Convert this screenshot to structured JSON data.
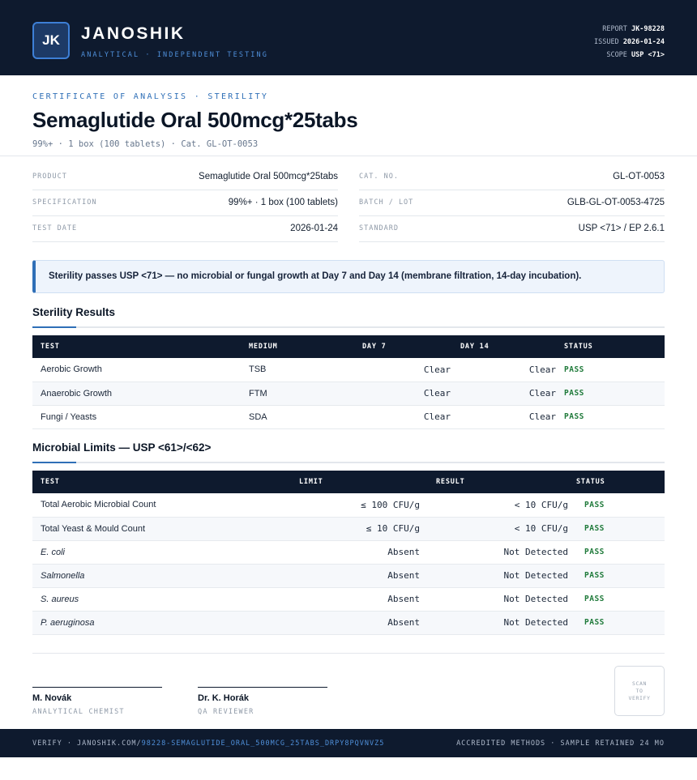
{
  "header": {
    "logo_initials": "JK",
    "brand": "JANOSHIK",
    "tagline": "ANALYTICAL · INDEPENDENT TESTING",
    "report_label": "REPORT",
    "report_value": "JK-98228",
    "issued_label": "ISSUED",
    "issued_value": "2026-01-24",
    "scope_label": "SCOPE",
    "scope_value": "USP <71>"
  },
  "doc": {
    "kicker": "CERTIFICATE OF ANALYSIS · STERILITY",
    "title": "Semaglutide Oral 500mcg*25tabs",
    "subtitle": "99%+ · 1 box (100 tablets)  ·  Cat. GL-OT-0053"
  },
  "info": {
    "product_label": "PRODUCT",
    "product_value": "Semaglutide Oral 500mcg*25tabs",
    "spec_label": "SPECIFICATION",
    "spec_value": "99%+ · 1 box (100 tablets)",
    "date_label": "TEST DATE",
    "date_value": "2026-01-24",
    "cat_label": "CAT. NO.",
    "cat_value": "GL-OT-0053",
    "batch_label": "BATCH / LOT",
    "batch_value": "GLB-GL-OT-0053-4725",
    "standard_label": "STANDARD",
    "standard_value": "USP <71> / EP 2.6.1"
  },
  "notice": "Sterility passes USP <71> — no microbial or fungal growth at Day 7 and Day 14 (membrane filtration, 14-day incubation).",
  "sterility": {
    "title": "Sterility Results",
    "headers": [
      "TEST",
      "MEDIUM",
      "DAY 7",
      "DAY 14",
      "STATUS"
    ],
    "rows": [
      {
        "test": "Aerobic Growth",
        "medium": "TSB",
        "day7": "Clear",
        "day14": "Clear",
        "status": "PASS"
      },
      {
        "test": "Anaerobic Growth",
        "medium": "FTM",
        "day7": "Clear",
        "day14": "Clear",
        "status": "PASS"
      },
      {
        "test": "Fungi / Yeasts",
        "medium": "SDA",
        "day7": "Clear",
        "day14": "Clear",
        "status": "PASS"
      }
    ]
  },
  "microbial": {
    "title": "Microbial Limits — USP <61>/<62>",
    "headers": [
      "TEST",
      "LIMIT",
      "RESULT",
      "STATUS"
    ],
    "rows": [
      {
        "test": "Total Aerobic Microbial Count",
        "limit": "≤ 100 CFU/g",
        "result": "< 10 CFU/g",
        "status": "PASS"
      },
      {
        "test": "Total Yeast & Mould Count",
        "limit": "≤ 10 CFU/g",
        "result": "< 10 CFU/g",
        "status": "PASS"
      },
      {
        "test": "E. coli",
        "limit": "Absent",
        "result": "Not Detected",
        "status": "PASS"
      },
      {
        "test": "Salmonella",
        "limit": "Absent",
        "result": "Not Detected",
        "status": "PASS"
      },
      {
        "test": "S. aureus",
        "limit": "Absent",
        "result": "Not Detected",
        "status": "PASS"
      },
      {
        "test": "P. aeruginosa",
        "limit": "Absent",
        "result": "Not Detected",
        "status": "PASS"
      }
    ]
  },
  "signatures": [
    {
      "name": "M. Novák",
      "role": "ANALYTICAL CHEMIST"
    },
    {
      "name": "Dr. K. Horák",
      "role": "QA REVIEWER"
    }
  ],
  "qr": {
    "line1": "SCAN",
    "line2": "TO",
    "line3": "VERIFY"
  },
  "footer": {
    "verify_prefix": "VERIFY · JANOSHIK.COM/",
    "verify_link": "98228-SEMAGLUTIDE_ORAL_500MCG_25TABS_DRPY8PQVNVZ5",
    "right": "ACCREDITED METHODS · SAMPLE RETAINED 24 MO"
  }
}
